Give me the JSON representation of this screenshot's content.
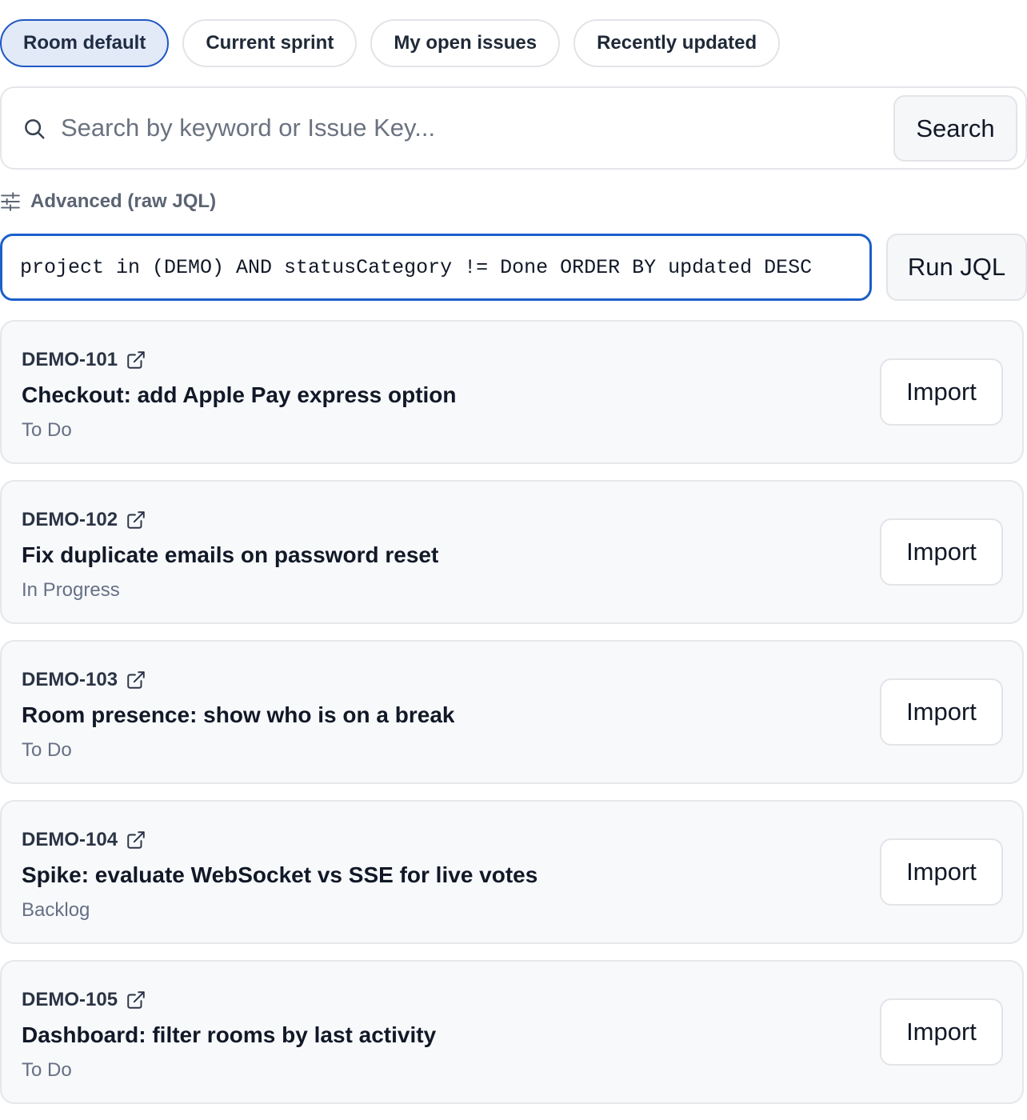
{
  "filters": {
    "chips": [
      {
        "label": "Room default",
        "active": true
      },
      {
        "label": "Current sprint",
        "active": false
      },
      {
        "label": "My open issues",
        "active": false
      },
      {
        "label": "Recently updated",
        "active": false
      }
    ]
  },
  "search": {
    "placeholder": "Search by keyword or Issue Key...",
    "value": "",
    "button_label": "Search",
    "icon": "search-icon"
  },
  "advanced": {
    "label": "Advanced (raw JQL)",
    "icon": "sliders-icon",
    "jql_value": "project in (DEMO) AND statusCategory != Done ORDER BY updated DESC",
    "run_label": "Run JQL"
  },
  "issues": [
    {
      "key": "DEMO-101",
      "title": "Checkout: add Apple Pay express option",
      "status": "To Do",
      "action_label": "Import"
    },
    {
      "key": "DEMO-102",
      "title": "Fix duplicate emails on password reset",
      "status": "In Progress",
      "action_label": "Import"
    },
    {
      "key": "DEMO-103",
      "title": "Room presence: show who is on a break",
      "status": "To Do",
      "action_label": "Import"
    },
    {
      "key": "DEMO-104",
      "title": "Spike: evaluate WebSocket vs SSE for live votes",
      "status": "Backlog",
      "action_label": "Import"
    },
    {
      "key": "DEMO-105",
      "title": "Dashboard: filter rooms by last activity",
      "status": "To Do",
      "action_label": "Import"
    }
  ],
  "colors": {
    "accent": "#1c5fca",
    "active_chip_bg": "#e2e9f7",
    "card_bg": "#f8f9fb",
    "border": "#e5e7eb",
    "muted_text": "#667085"
  }
}
